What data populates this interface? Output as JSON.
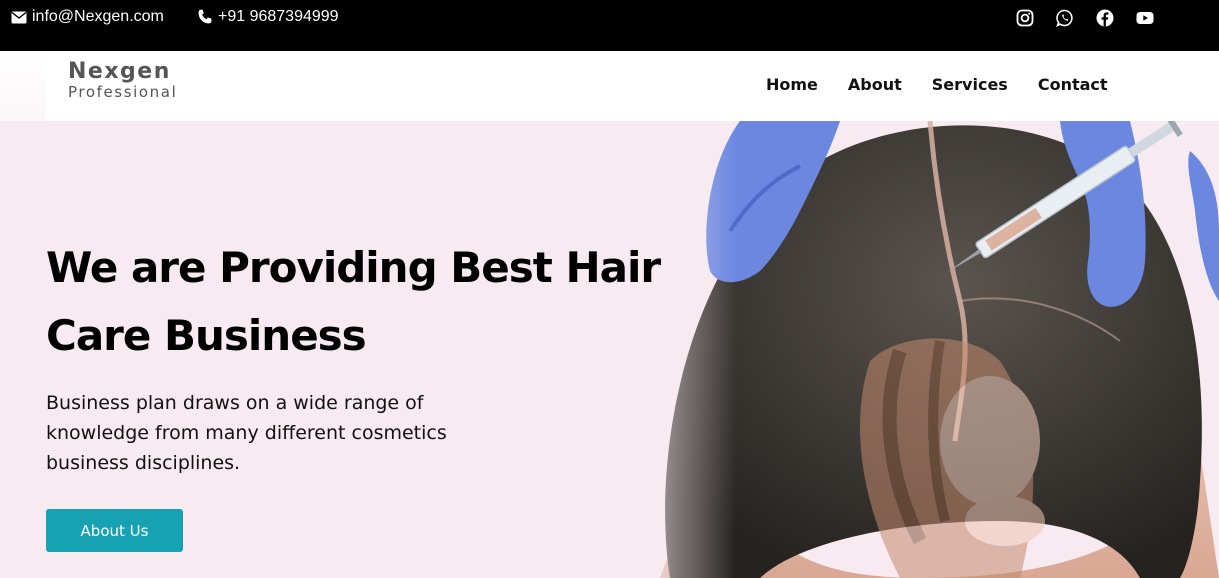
{
  "topbar": {
    "email": "info@Nexgen.com",
    "phone": "+91 9687394999",
    "social_icons": [
      "instagram-icon",
      "whatsapp-icon",
      "facebook-icon",
      "youtube-icon"
    ]
  },
  "brand": {
    "name": "Nexgen",
    "tagline": "Professional"
  },
  "nav": {
    "items": [
      {
        "label": "Home"
      },
      {
        "label": "About"
      },
      {
        "label": "Services"
      },
      {
        "label": "Contact"
      }
    ]
  },
  "hero": {
    "headline_line1": "We are Providing Best Hair",
    "headline_line2": "Care Business",
    "subtext": "Business plan draws on a wide range of knowledge from many different cosmetics business disciplines.",
    "cta_label": "About Us",
    "image_subject": "gloved hands injecting scalp of woman with hair parting; faded portrait of woman with curly hair"
  },
  "colors": {
    "topbar_bg": "#000000",
    "hero_bg": "#f7eaf0",
    "accent": "#17a2b3",
    "text": "#000000"
  }
}
